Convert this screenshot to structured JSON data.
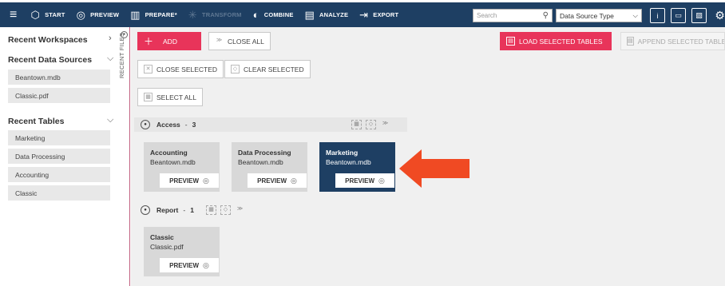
{
  "colors": {
    "topbar": "#1e3f63",
    "accent": "#e8345a",
    "arrow": "#f04a23",
    "selected_card": "#1e3f63"
  },
  "toolbar": {
    "menu_icon": "hamburger-icon",
    "items": [
      {
        "label": "START",
        "icon": "cube-icon"
      },
      {
        "label": "PREVIEW",
        "icon": "eye-icon"
      },
      {
        "label": "PREPARE*",
        "icon": "table-icon"
      },
      {
        "label": "TRANSFORM",
        "icon": "sparkle-icon"
      },
      {
        "label": "COMBINE",
        "icon": "combine-icon"
      },
      {
        "label": "ANALYZE",
        "icon": "document-icon"
      },
      {
        "label": "EXPORT",
        "icon": "export-icon"
      }
    ],
    "search_placeholder": "Search",
    "data_source_type": "Data Source Type"
  },
  "sidebar": {
    "recent_workspaces": "Recent Workspaces",
    "recent_data_sources": "Recent Data Sources",
    "data_sources": [
      "Beantown.mdb",
      "Classic.pdf"
    ],
    "recent_tables": "Recent Tables",
    "tables": [
      "Marketing",
      "Data Processing",
      "Accounting",
      "Classic"
    ],
    "vertical_tab": "RECENT FILES"
  },
  "actions": {
    "add": "ADD",
    "close_all": "CLOSE ALL",
    "close_selected": "CLOSE SELECTED",
    "clear_selected": "CLEAR SELECTED",
    "select_all": "SELECT ALL",
    "load_selected": "LOAD SELECTED TABLES",
    "append_selected": "APPEND SELECTED TABLES"
  },
  "groups": [
    {
      "name": "Access",
      "sep": "-",
      "count": "3",
      "tables": [
        {
          "name": "Accounting",
          "source": "Beantown.mdb",
          "preview": "PREVIEW",
          "selected": false
        },
        {
          "name": "Data Processing",
          "source": "Beantown.mdb",
          "preview": "PREVIEW",
          "selected": false
        },
        {
          "name": "Marketing",
          "source": "Beantown.mdb",
          "preview": "PREVIEW",
          "selected": true
        }
      ]
    },
    {
      "name": "Report",
      "sep": "-",
      "count": "1",
      "tables": [
        {
          "name": "Classic",
          "source": "Classic.pdf",
          "preview": "PREVIEW",
          "selected": false
        }
      ]
    }
  ]
}
